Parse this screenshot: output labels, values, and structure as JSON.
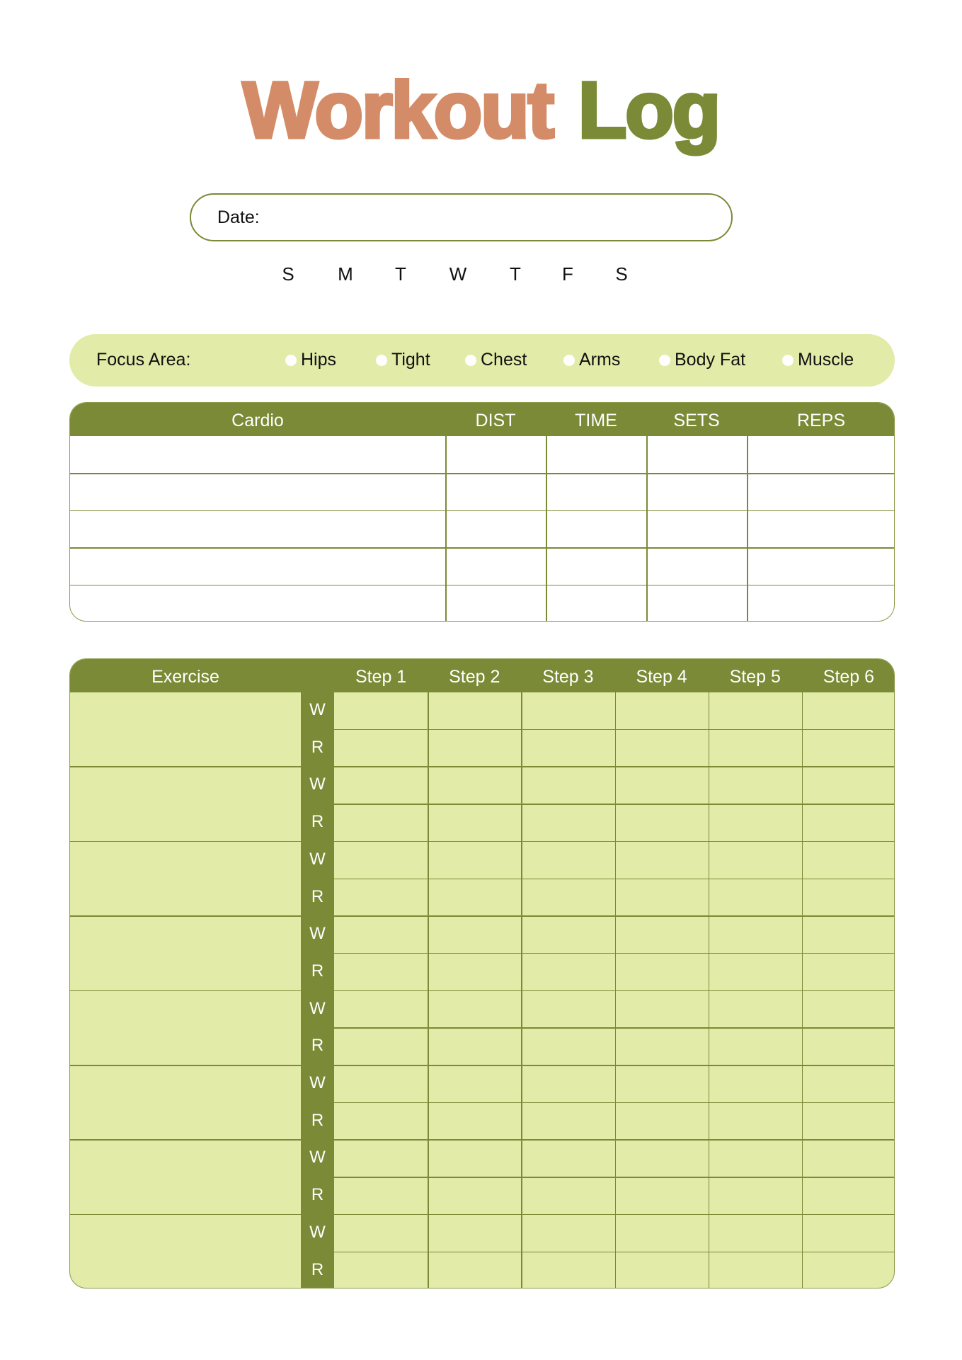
{
  "title": {
    "part1": "Workout",
    "part2": "Log"
  },
  "date": {
    "label": "Date:",
    "value": ""
  },
  "days": [
    "S",
    "M",
    "T",
    "W",
    "T",
    "F",
    "S"
  ],
  "focus": {
    "label": "Focus Area:",
    "options": [
      "Hips",
      "Tight",
      "Chest",
      "Arms",
      "Body Fat",
      "Muscle"
    ]
  },
  "cardio": {
    "headers": [
      "Cardio",
      "DIST",
      "TIME",
      "SETS",
      "REPS"
    ],
    "rows": [
      [
        "",
        "",
        "",
        "",
        ""
      ],
      [
        "",
        "",
        "",
        "",
        ""
      ],
      [
        "",
        "",
        "",
        "",
        ""
      ],
      [
        "",
        "",
        "",
        "",
        ""
      ],
      [
        "",
        "",
        "",
        "",
        ""
      ]
    ]
  },
  "exercise": {
    "header": "Exercise",
    "steps": [
      "Step 1",
      "Step 2",
      "Step 3",
      "Step 4",
      "Step 5",
      "Step 6"
    ],
    "row_labels": [
      "W",
      "R"
    ],
    "block_count": 8
  },
  "colors": {
    "accent_green": "#7a8a36",
    "light_green": "#e3eba8",
    "title_orange": "#d48c68"
  }
}
